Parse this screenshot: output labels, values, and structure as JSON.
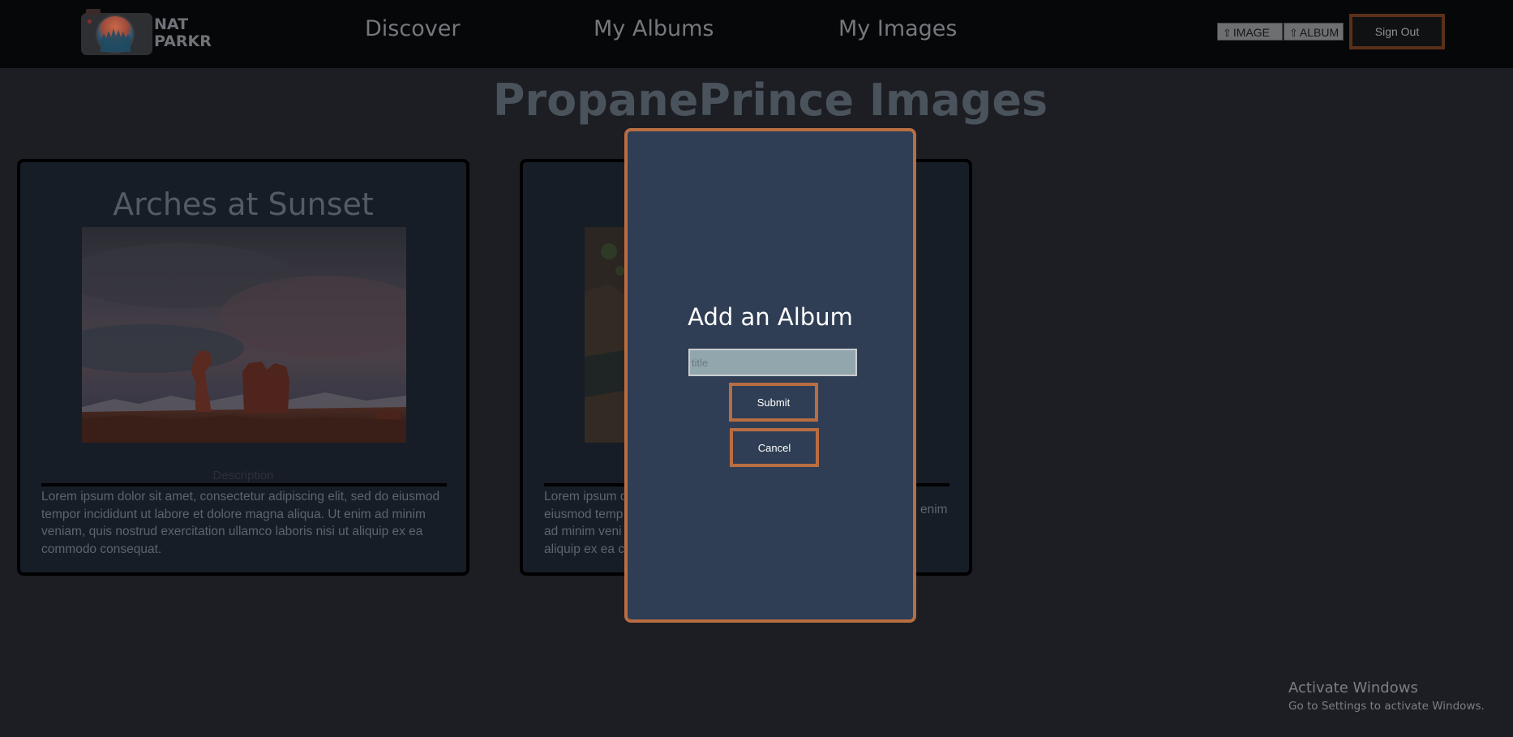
{
  "logo": {
    "line1": "NAT",
    "line2": "PARKR"
  },
  "nav": {
    "links": [
      "Discover",
      "My Albums",
      "My Images"
    ],
    "upload_image_label": "IMAGE",
    "upload_album_label": "ALBUM",
    "sign_out_label": "Sign Out"
  },
  "page": {
    "title": "PropanePrince Images"
  },
  "cards": [
    {
      "title": "Arches at Sunset",
      "description_label": "Description",
      "description": "Lorem ipsum dolor sit amet, consectetur adipiscing elit, sed do eiusmod tempor incididunt ut labore et dolore magna aliqua. Ut enim ad minim veniam, quis nostrud exercitation ullamco laboris nisi ut aliquip ex ea commodo consequat."
    },
    {
      "description_visible": "Lorem ipsum d… eiusmod temp… ad minim veni… aliquip ex ea c…"
    }
  ],
  "modal": {
    "title": "Add an Album",
    "input_placeholder": "title",
    "input_value": "",
    "submit_label": "Submit",
    "cancel_label": "Cancel"
  },
  "watermark": {
    "title": "Activate Windows",
    "subtitle": "Go to Settings to activate Windows."
  },
  "colors": {
    "background": "#1c1e23",
    "navbar": "#060708",
    "modal_background": "#2f3e54",
    "accent_border": "#b96d42",
    "card_background": "#161d27"
  },
  "icons": {
    "upload": "upload-arrow-icon",
    "logo": "camera-logo-icon"
  }
}
